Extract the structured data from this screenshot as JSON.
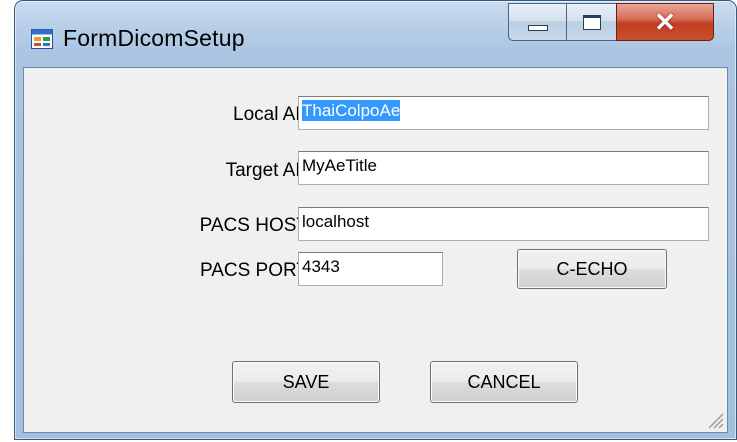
{
  "window": {
    "title": "FormDicomSetup"
  },
  "form": {
    "local_ae": {
      "label": "Local AE",
      "value": "ThaiColpoAe"
    },
    "target_ae": {
      "label": "Target AE",
      "value": "MyAeTitle"
    },
    "pacs_host": {
      "label": "PACS HOST",
      "value": "localhost"
    },
    "pacs_port": {
      "label": "PACS PORT",
      "value": "4343"
    }
  },
  "buttons": {
    "cecho": "C-ECHO",
    "save": "SAVE",
    "cancel": "CANCEL"
  },
  "icons": {
    "app": "form-icon",
    "minimize": "minimize-icon",
    "maximize": "maximize-icon",
    "close": "close-icon",
    "grip": "resize-grip-icon"
  },
  "colors": {
    "selection": "#3399ff",
    "close_button": "#c84a2c",
    "client_bg": "#f0f0f0"
  }
}
